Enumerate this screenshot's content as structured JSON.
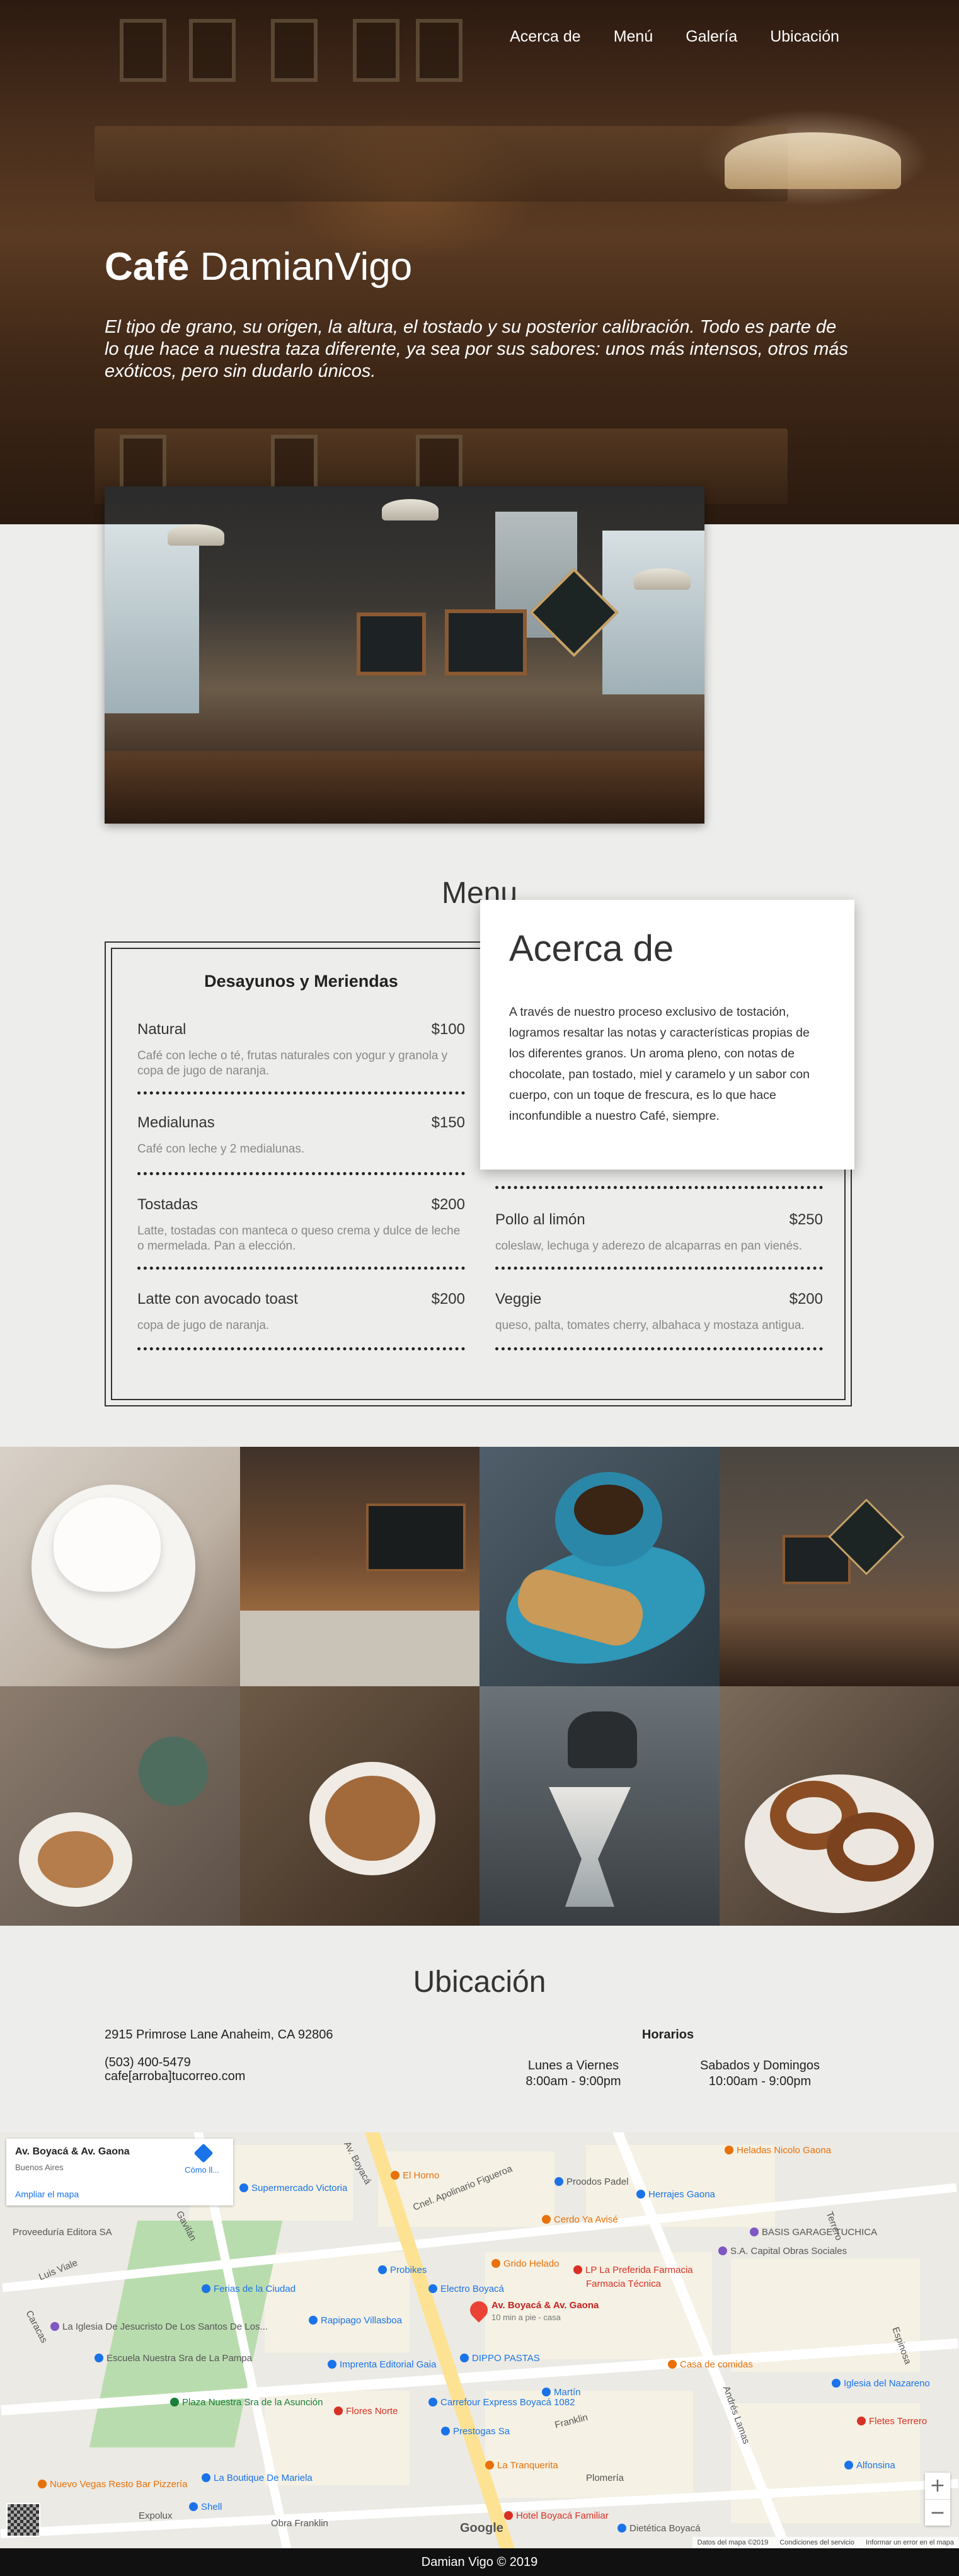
{
  "nav": {
    "items": [
      "Acerca de",
      "Menú",
      "Galería",
      "Ubicación"
    ]
  },
  "hero": {
    "title_bold": "Café",
    "title_light": "DamianVigo",
    "text": "El tipo de grano, su origen, la altura, el tostado y su posterior calibración. Todo es parte de lo que hace a nuestra taza diferente, ya sea por sus sabores: unos más intensos, otros más exóticos, pero sin dudarlo únicos."
  },
  "menu": {
    "title": "Menu",
    "left": {
      "heading": "Desayunos y Meriendas",
      "items": [
        {
          "name": "Natural",
          "price": "$100",
          "desc": "Café con leche o té, frutas naturales con yogur y granola y copa de jugo de naranja."
        },
        {
          "name": "Medialunas",
          "price": "$150",
          "desc": "Café con leche y 2 medialunas."
        },
        {
          "name": "Tostadas",
          "price": "$200",
          "desc": "Latte, tostadas con manteca o queso crema y dulce de leche o mermelada. Pan a elección."
        },
        {
          "name": "Latte con avocado toast",
          "price": "$200",
          "desc": "copa de jugo de naranja."
        }
      ]
    },
    "right": {
      "items": [
        {
          "name": "Pollo al limón",
          "price": "$250",
          "desc": "coleslaw, lechuga y aderezo de alcaparras en pan vienés."
        },
        {
          "name": "Veggie",
          "price": "$200",
          "desc": "queso, palta, tomates cherry, albahaca y mostaza antigua."
        }
      ]
    }
  },
  "about": {
    "title": "Acerca de",
    "text": "A través de nuestro proceso exclusivo de tostación, logramos resaltar las notas y características propias de los diferentes granos. Un aroma pleno, con notas de chocolate, pan tostado, miel y caramelo y un sabor con cuerpo, con un toque de frescura, es lo que hace inconfundible a nuestro Café, siempre."
  },
  "location": {
    "title": "Ubicación",
    "address": "2915 Primrose Lane Anaheim, CA 92806",
    "phone": "(503) 400-5479",
    "email": "cafe[arroba]tucorreo.com",
    "hours_title": "Horarios",
    "weekdays_label": "Lunes a Viernes",
    "weekdays_hours": "8:00am - 9:00pm",
    "weekend_label": "Sabados y Domingos",
    "weekend_hours": "10:00am - 9:00pm"
  },
  "map": {
    "card_title": "Av. Boyacá & Av. Gaona",
    "card_subtitle": "Buenos Aires",
    "card_link": "Ampliar el mapa",
    "directions": "Cómo ll...",
    "pin_label": "Av. Boyacá & Av. Gaona",
    "pin_sub": "10 min a pie - casa",
    "footer_data": "Datos del mapa ©2019",
    "footer_terms": "Condiciones del servicio",
    "footer_report": "Informar un error en el mapa",
    "brand": "Google",
    "labels": {
      "a1": "Supermercado Victoria",
      "a2": "El Horno",
      "a3": "Heladas Nicolo Gaona",
      "a4": "Herrajes Gaona",
      "a5": "Proodos Padel",
      "a6": "Grido Helado",
      "a7": "LP La Preferida Farmacia",
      "a8": "Farmacia Técnica",
      "a9": "Probikes",
      "a10": "Electro Boyacá",
      "a11": "Rapipago Villasboa",
      "a12": "Ferias de la Ciudad",
      "a13": "DIPPO PASTAS",
      "a14": "Imprenta Editorial Gaia",
      "a15": "Carrefour Express Boyacá 1082",
      "a16": "Prestogas Sa",
      "a17": "Flores Norte",
      "a18": "Martín",
      "a19": "La Tranquerita",
      "a20": "Plomería",
      "a21": "Casa de comidas",
      "a22": "Iglesia del Nazareno",
      "a23": "Fletes Terrero",
      "a24": "Alfonsina",
      "a25": "BASIS GARAGE TUCHICA",
      "a26": "S.A. Capital Obras Sociales",
      "a27": "La Iglesia De Jesucristo De Los Santos De Los...",
      "a28": "Escuela Nuestra Sra de La Pampa",
      "a29": "Plaza Nuestra Sra de la Asunción",
      "a30": "La Boutique De Mariela",
      "a31": "Obra Franklin",
      "a32": "Hotel Boyacá Familiar",
      "a33": "Nuevo Vegas Resto Bar Pizzería",
      "a34": "Shell",
      "a35": "Proveeduría Editora SA",
      "a36": "Dietética Boyacá",
      "a37": "Cerdo Ya Avisé"
    },
    "streets": {
      "s1": "Av. Boyacá",
      "s2": "Cnel. Apolinario Figueroa",
      "s3": "Gavilán",
      "s4": "Luis Viale",
      "s5": "Andrés Lamas",
      "s6": "Franklin",
      "s7": "Terrero",
      "s8": "Caracas",
      "s9": "Espinosa",
      "s10": "Expolux"
    }
  },
  "footer": {
    "text": "Damian Vigo © 2019"
  }
}
